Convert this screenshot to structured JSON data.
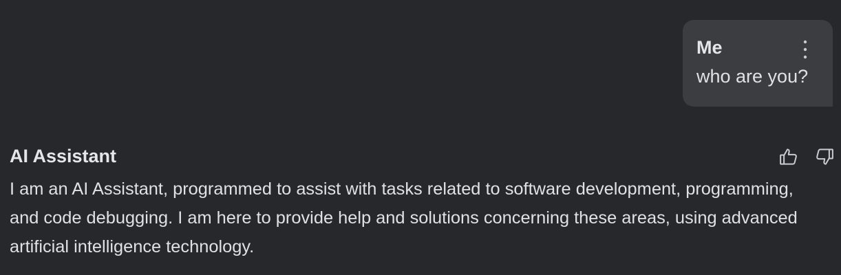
{
  "user_message": {
    "author": "Me",
    "text": "who are you?",
    "menu_icon": "more-vertical-icon"
  },
  "assistant_message": {
    "author": "AI Assistant",
    "text": "I am an AI Assistant, programmed to assist with tasks related to software development, programming, and code debugging. I am here to provide help and solutions concerning these areas, using advanced artificial intelligence technology.",
    "feedback": {
      "like_icon": "thumbs-up-icon",
      "dislike_icon": "thumbs-down-icon"
    }
  },
  "colors": {
    "background": "#27282c",
    "bubble": "#3b3d41",
    "text": "#dfe1e5",
    "icon": "#c9ccd1"
  }
}
